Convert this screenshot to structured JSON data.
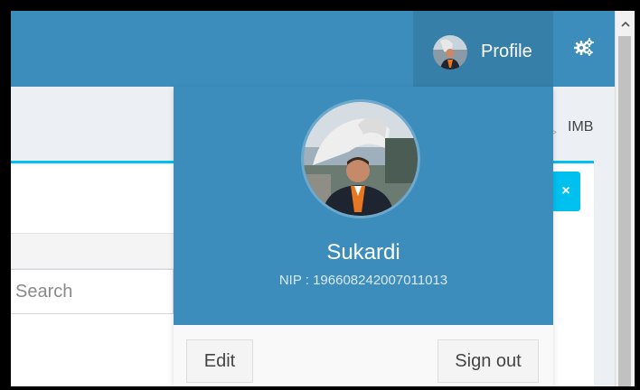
{
  "navbar": {
    "profile_label": "Profile",
    "settings_icon": "gears-icon",
    "avatar_icon": "user-avatar"
  },
  "breadcrumb": {
    "current": "IMB"
  },
  "search": {
    "placeholder": "Search"
  },
  "box": {
    "close_label": "×"
  },
  "user_panel": {
    "name": "Sukardi",
    "nip": "NIP : 196608242007011013",
    "edit_label": "Edit",
    "signout_label": "Sign out"
  },
  "colors": {
    "navbar": "#3c8dbc",
    "navbar_active": "#367fa9",
    "accent": "#00c0ef"
  }
}
